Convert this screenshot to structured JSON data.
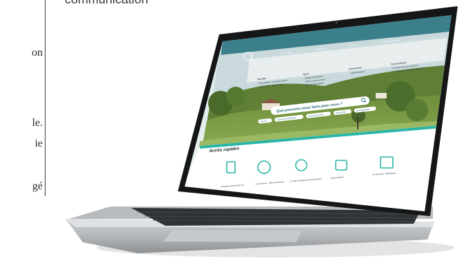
{
  "left_text": {
    "lines": [
      "on",
      "le.",
      "ie",
      "gé"
    ]
  },
  "caption": "communication",
  "website": {
    "nav": {
      "items": [
        "Ma ville",
        "Pratique",
        "Actu",
        "Participative"
      ]
    },
    "mega_menu": {
      "columns": [
        {
          "title": "Ma Ville",
          "items": [
            "Présentation · Agenda annuel",
            "et lieux des · Monuments"
          ]
        },
        {
          "title": "Sport",
          "items": [
            "· Stades municipaux",
            "· Salles sous-secteurs",
            "· Bientôt disponibles"
          ]
        },
        {
          "title": "Événements",
          "items": [
            "· Manifestations"
          ]
        },
        {
          "title": "Vie associative",
          "items": [
            "· Annuaire des associations",
            "· La 'Salle guadeloupe' associative"
          ]
        }
      ]
    },
    "hero": {
      "search_placeholder": "Que pouvons-nous faire pour vous ?",
      "pills": [
        "Jeunes",
        "Logement temporaire",
        "Accès à la mairie",
        "Démarches",
        "Aménagement"
      ]
    },
    "quick": {
      "title": "Accès rapides",
      "items": [
        "Demande d'acte d'état civil",
        "La Commune · Salle de spectacle",
        "La Salle Polyvalente des associations",
        "Espace famille",
        "Le Verbe être · Bibliothèque"
      ]
    },
    "colors": {
      "accent": "#2ab5a8",
      "nav": "#3b7f8a",
      "menu": "#e9edee"
    }
  }
}
